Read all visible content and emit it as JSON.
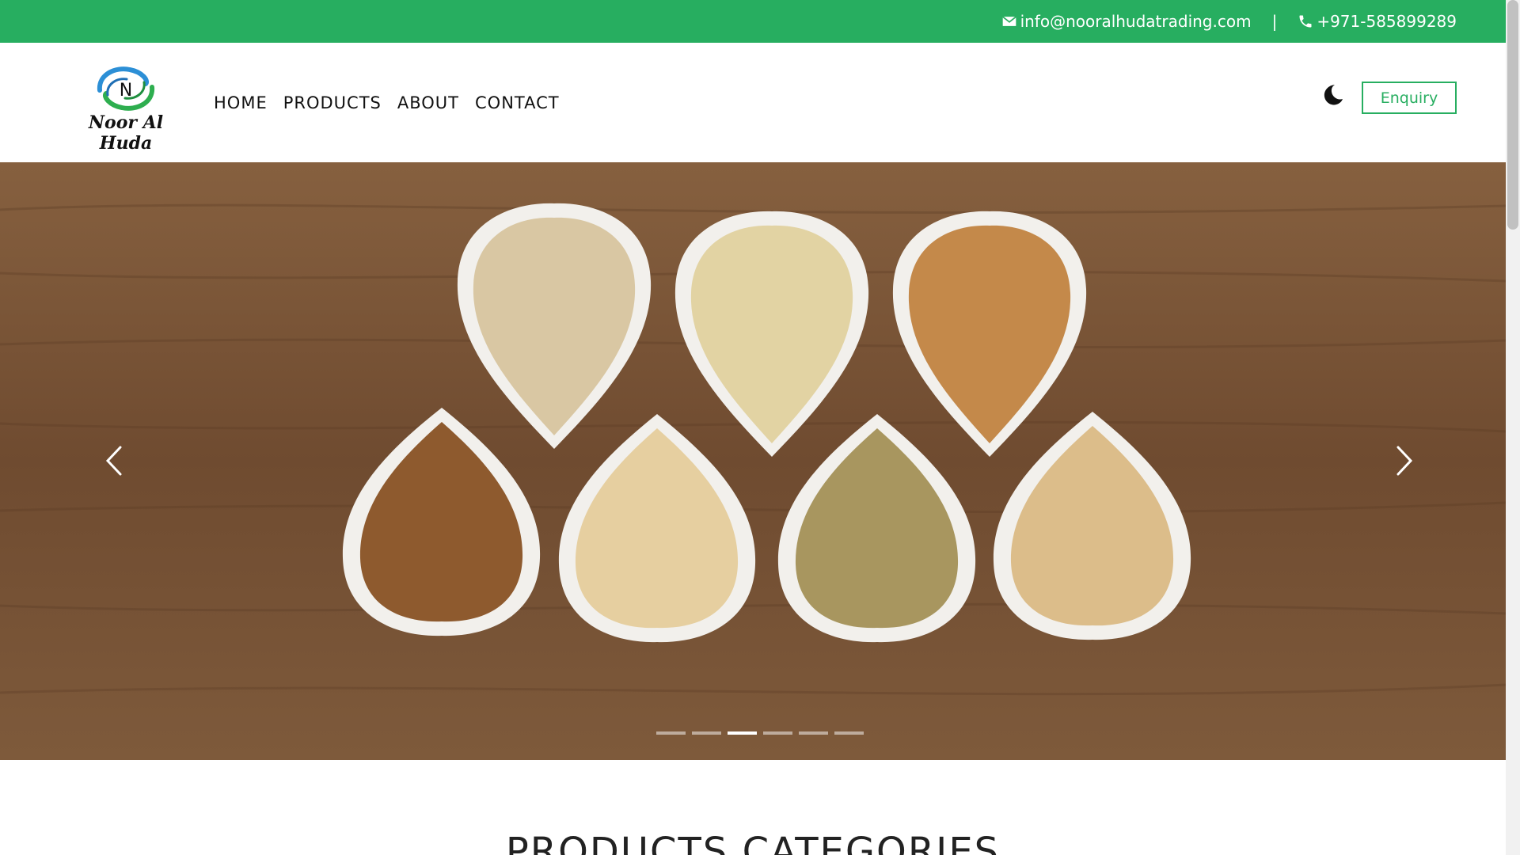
{
  "topbar": {
    "email": "info@nooralhudatrading.com",
    "separator": "|",
    "phone": "+971-585899289",
    "email_icon": "envelope-icon",
    "phone_icon": "phone-icon"
  },
  "header": {
    "logo_letter": "N",
    "logo_name": "Noor Al Huda",
    "nav": [
      "HOME",
      "PRODUCTS",
      "ABOUT",
      "CONTACT"
    ],
    "theme_toggle_icon": "moon-icon",
    "enquiry_label": "Enquiry"
  },
  "hero": {
    "slide_count": 6,
    "active_slide": 3,
    "prev_icon": "chevron-left-icon",
    "next_icon": "chevron-right-icon"
  },
  "section": {
    "title": "PRODUCTS CATEGORIES"
  },
  "colors": {
    "brand_green": "#27ae60",
    "hero_wood": "#7a5538"
  }
}
